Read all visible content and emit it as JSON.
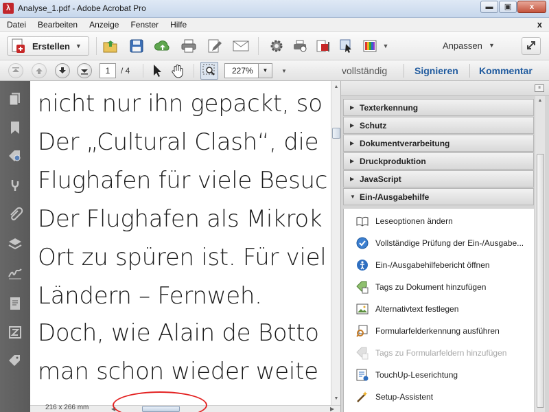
{
  "window": {
    "title": "Analyse_1.pdf - Adobe Acrobat Pro",
    "app_icon": "acrobat-icon",
    "controls": {
      "minimize": "▬",
      "maximize": "▣",
      "close": "x"
    }
  },
  "menubar": {
    "items": [
      "Datei",
      "Bearbeiten",
      "Anzeige",
      "Fenster",
      "Hilfe"
    ],
    "close": "x"
  },
  "toolbar1": {
    "create_label": "Erstellen",
    "icons": [
      "open-folder-icon",
      "save-disk-icon",
      "cloud-upload-icon",
      "print-icon",
      "edit-icon",
      "email-icon",
      "settings-gear-icon",
      "print-production-icon",
      "pdf-export-icon",
      "select-cursor-icon",
      "color-palette-icon"
    ],
    "customize_label": "Anpassen",
    "expand_icon": "expand-icon"
  },
  "toolbar2": {
    "page_current": "1",
    "page_total": "/ 4",
    "zoom": "227%",
    "links": {
      "full": "vollständig",
      "sign": "Signieren",
      "comment": "Kommentar"
    }
  },
  "leftnav": {
    "icons": [
      "pages-icon",
      "bookmark-icon",
      "tag-search-icon",
      "link-icon",
      "attachment-icon",
      "layers-icon",
      "signature-icon",
      "content-icon",
      "standards-icon",
      "tag-icon"
    ]
  },
  "document": {
    "lines": [
      "nicht nur ihn gepackt, so",
      "Der „Cultural Clash“, die",
      "Flughafen für viele Besuc",
      "Der Flughafen als Mikrok",
      "Ort zu spüren ist. Für viel",
      "Ländern – Fernweh.",
      "Doch, wie Alain de Botto",
      "man schon wieder weite"
    ],
    "page_dimensions": "216 x 266 mm"
  },
  "rightpanel": {
    "sections": [
      {
        "title": "Texterkennung",
        "expanded": false
      },
      {
        "title": "Schutz",
        "expanded": false
      },
      {
        "title": "Dokumentverarbeitung",
        "expanded": false
      },
      {
        "title": "Druckproduktion",
        "expanded": false
      },
      {
        "title": "JavaScript",
        "expanded": false
      },
      {
        "title": "Ein-/Ausgabehilfe",
        "expanded": true
      }
    ],
    "tools": [
      {
        "label": "Leseoptionen ändern",
        "icon": "book-icon",
        "disabled": false
      },
      {
        "label": "Vollständige Prüfung der Ein-/Ausgabe...",
        "icon": "check-circle-icon",
        "disabled": false
      },
      {
        "label": "Ein-/Ausgabehilfebericht öffnen",
        "icon": "accessibility-icon",
        "disabled": false
      },
      {
        "label": "Tags zu Dokument hinzufügen",
        "icon": "add-tags-icon",
        "disabled": false
      },
      {
        "label": "Alternativtext festlegen",
        "icon": "image-text-icon",
        "disabled": false
      },
      {
        "label": "Formularfelderkennung ausführen",
        "icon": "form-detect-icon",
        "disabled": false
      },
      {
        "label": "Tags zu Formularfeldern hinzufügen",
        "icon": "form-tags-icon",
        "disabled": true
      },
      {
        "label": "TouchUp-Leserichtung",
        "icon": "touchup-icon",
        "disabled": false
      },
      {
        "label": "Setup-Assistent",
        "icon": "wizard-icon",
        "disabled": false
      }
    ]
  },
  "colors": {
    "accent_blue": "#1f5a9e",
    "annotation_red": "#e32222",
    "nav_panel": "#5e5e5e"
  }
}
